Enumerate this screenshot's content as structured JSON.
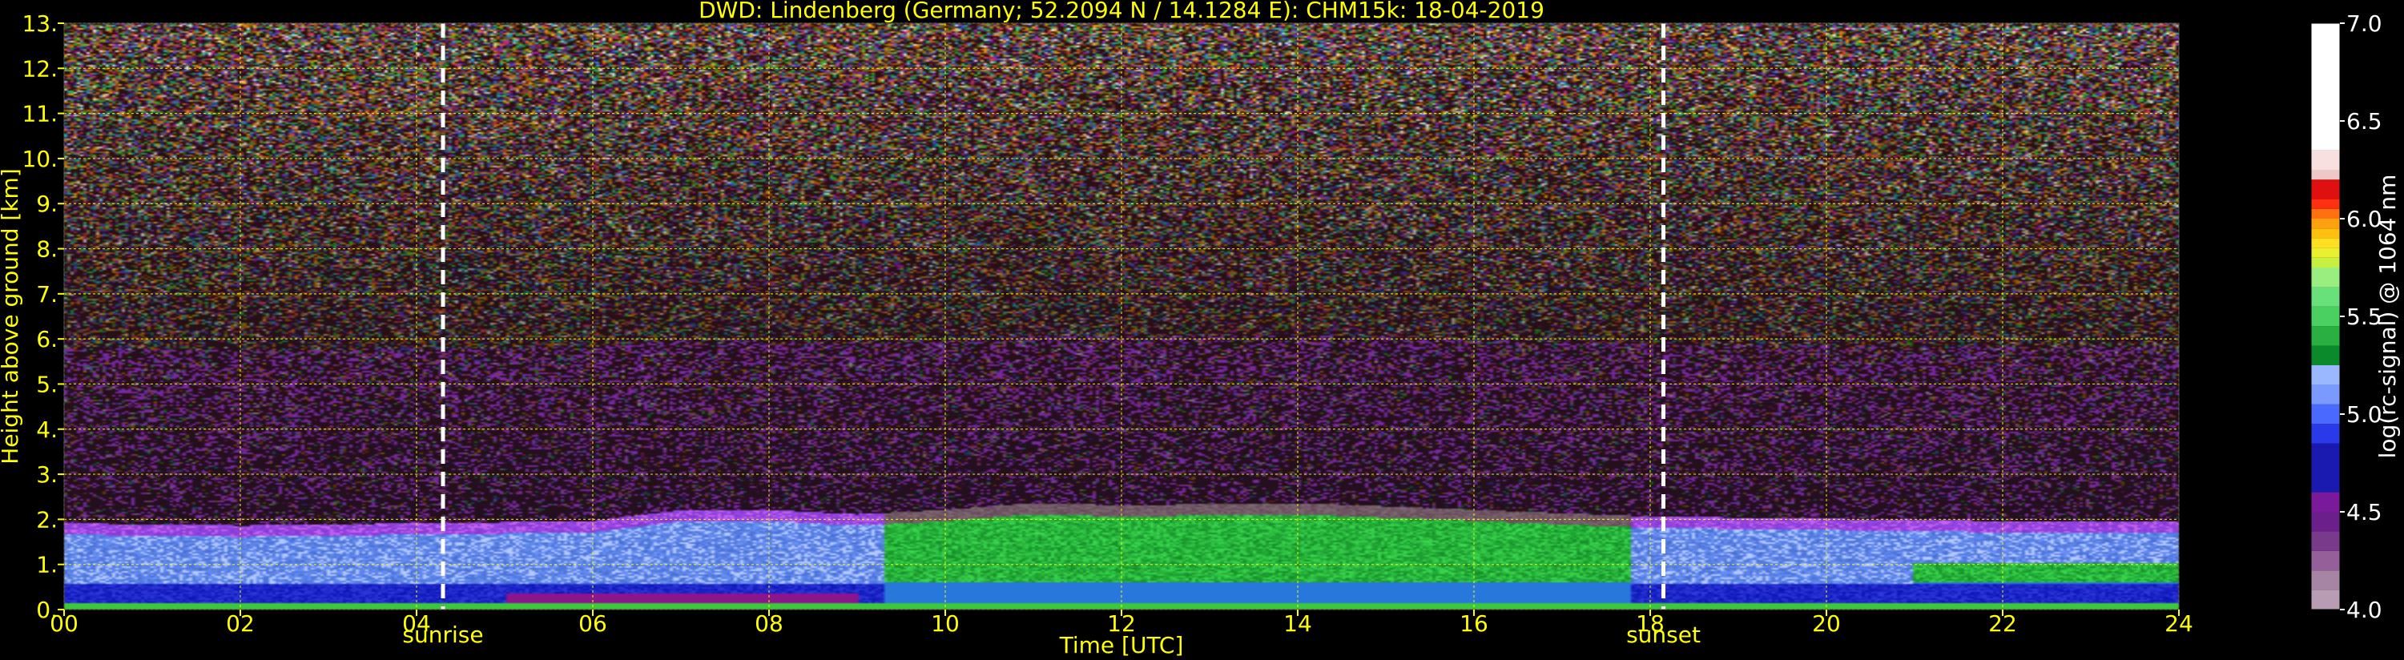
{
  "chart_data": {
    "type": "heatmap",
    "title": "DWD: Lindenberg (Germany; 52.2094 N / 14.1284 E):    CHM15k: 18-04-2019",
    "xlabel": "Time [UTC]",
    "ylabel": "Height above ground [km]",
    "xlim": [
      0,
      24
    ],
    "ylim": [
      0,
      13
    ],
    "x_ticks": [
      0,
      2,
      4,
      6,
      8,
      10,
      12,
      14,
      16,
      18,
      20,
      22,
      24
    ],
    "x_tick_labels": [
      "00",
      "02",
      "04",
      "06",
      "08",
      "10",
      "12",
      "14",
      "16",
      "18",
      "20",
      "22",
      "24"
    ],
    "y_ticks": [
      0,
      1,
      2,
      3,
      4,
      5,
      6,
      7,
      8,
      9,
      10,
      11,
      12,
      13
    ],
    "y_tick_labels": [
      "0.",
      "1.",
      "2.",
      "3.",
      "4.",
      "5.",
      "6.",
      "7.",
      "8.",
      "9.",
      "10.",
      "11.",
      "12.",
      "13."
    ],
    "grid": true,
    "annotations": [
      {
        "name": "sunrise",
        "x": 4.3
      },
      {
        "name": "sunset",
        "x": 18.15
      }
    ],
    "colorbar": {
      "label": "log(rc-signal) @ 1064 nm",
      "range": [
        4.0,
        7.0
      ],
      "ticks": [
        4.0,
        4.5,
        5.0,
        5.5,
        6.0,
        6.5,
        7.0
      ],
      "tick_labels": [
        "4.0",
        "4.5",
        "5.0",
        "5.5",
        "6.0",
        "6.5",
        "7.0"
      ]
    },
    "boundary_layer_top_km": [
      [
        0,
        1.9
      ],
      [
        2,
        1.85
      ],
      [
        4,
        1.9
      ],
      [
        6,
        1.95
      ],
      [
        7,
        2.2
      ],
      [
        8,
        2.2
      ],
      [
        9,
        2.1
      ],
      [
        10,
        2.2
      ],
      [
        11,
        2.35
      ],
      [
        12,
        2.3
      ],
      [
        14,
        2.35
      ],
      [
        16,
        2.2
      ],
      [
        18,
        2.05
      ],
      [
        20,
        2.0
      ],
      [
        22,
        1.95
      ],
      [
        24,
        1.95
      ]
    ]
  },
  "colors": {
    "axis_text": "#ffff00",
    "grid": "#ffff00",
    "background": "#000000",
    "marker_line": "#ffffff"
  }
}
